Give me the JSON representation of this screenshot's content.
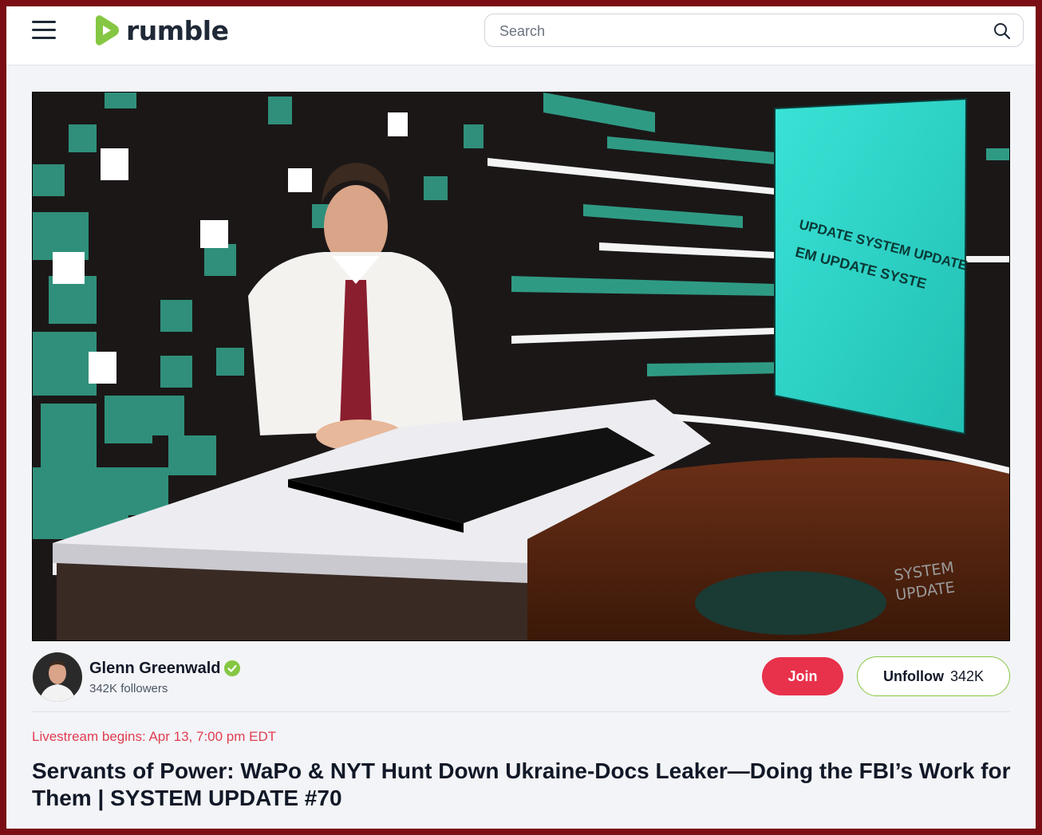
{
  "header": {
    "brand": "rumble",
    "search_placeholder": "Search"
  },
  "video": {
    "screen_text_line1": "UPDATE SYSTEM UPDATE",
    "screen_text_line2": "EM UPDATE SYSTE",
    "watermark_line1": "SYSTEM",
    "watermark_line2": "UPDATE"
  },
  "channel": {
    "name": "Glenn Greenwald",
    "followers": "342K followers",
    "join_label": "Join",
    "unfollow_label": "Unfollow",
    "unfollow_count": "342K"
  },
  "livestream": "Livestream begins: Apr 13, 7:00 pm EDT",
  "title": "Servants of Power: WaPo & NYT Hunt Down Ukraine-Docs Leaker—Doing the FBI’s Work for Them | SYSTEM UPDATE #70",
  "colors": {
    "brand_green": "#85c742",
    "join_red": "#e8314b",
    "live_red": "#e03e52",
    "frame_border": "#7a0e14"
  }
}
